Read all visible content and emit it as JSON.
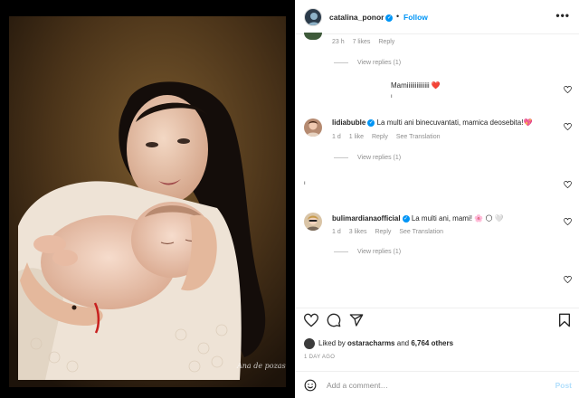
{
  "post": {
    "username": "catalina_ponor",
    "follow_label": "Follow",
    "separator": "•",
    "more_label": "•••",
    "signature_text": "Ana de pozas"
  },
  "comments": [
    {
      "meta": {
        "time": "23 h",
        "likes": "7 likes",
        "reply": "Reply"
      },
      "view_replies": "View replies (1)"
    },
    {
      "text": "Mamiiiiiiiiiiiiii",
      "emoji": "❤️"
    },
    {
      "username": "lidiabuble",
      "text": "La multi ani binecuvantati, mamica deosebita!",
      "emoji": "💖",
      "meta": {
        "time": "1 d",
        "likes": "1 like",
        "reply": "Reply",
        "translation": "See Translation"
      },
      "view_replies": "View replies (1)"
    },
    {
      "username": "bulimardianaofficial",
      "text": "La multi ani, mami!",
      "emoji": "🌸 🌕 🤍",
      "meta": {
        "time": "1 d",
        "likes": "3 likes",
        "reply": "Reply",
        "translation": "See Translation"
      },
      "view_replies": "View replies (1)"
    }
  ],
  "likes": {
    "prefix": "Liked by",
    "user": "ostaracharms",
    "and": "and",
    "count": "6,764 others"
  },
  "date": "1 DAY AGO",
  "add_comment": {
    "placeholder": "Add a comment…",
    "post_label": "Post"
  },
  "colors": {
    "link_blue": "#0095f6",
    "post_disabled": "#b2dffc",
    "muted": "#8e8e8e",
    "like_red": "#ed4956"
  }
}
